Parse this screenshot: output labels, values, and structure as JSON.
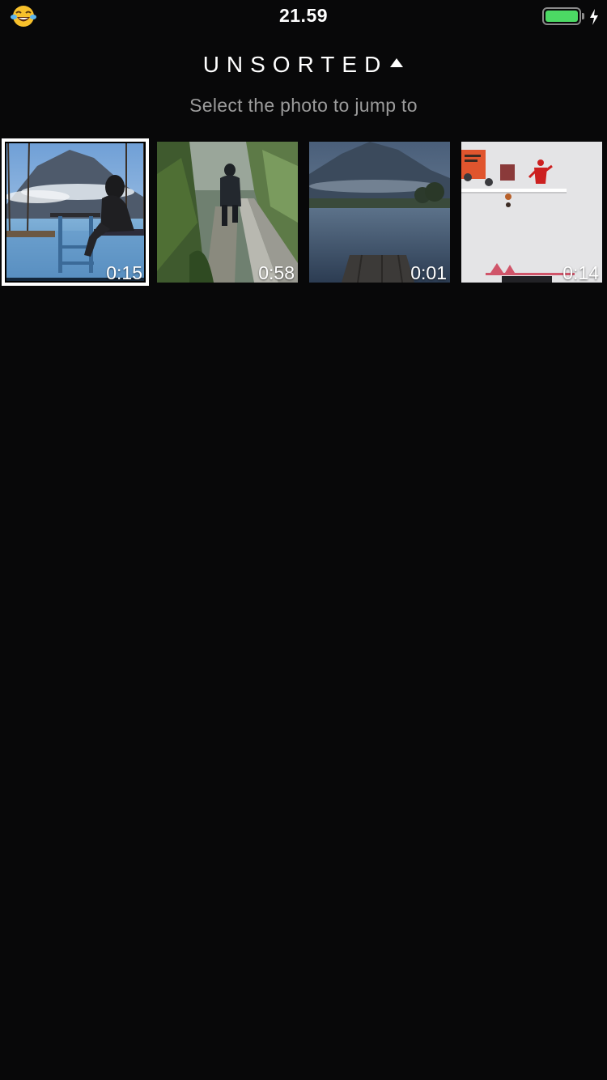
{
  "status_bar": {
    "time": "21.59",
    "battery_color": "#4cd964",
    "left_icon": "tears-of-joy-emoji-icon",
    "right_icon": "charging-bolt-icon"
  },
  "header": {
    "title": "UNSORTED",
    "title_icon": "caret-up-icon",
    "subtitle": "Select the photo to jump to"
  },
  "thumbnails": [
    {
      "duration": "0:15",
      "selected": true,
      "subject": "swing-mountain-lake"
    },
    {
      "duration": "0:58",
      "selected": false,
      "subject": "person-on-path"
    },
    {
      "duration": "0:01",
      "selected": false,
      "subject": "lake-dock-mountain"
    },
    {
      "duration": "0:14",
      "selected": false,
      "subject": "shelf-figures"
    }
  ],
  "colors": {
    "background": "#080809",
    "subtitle": "#9b9b9b",
    "selection_border": "#ffffff"
  }
}
